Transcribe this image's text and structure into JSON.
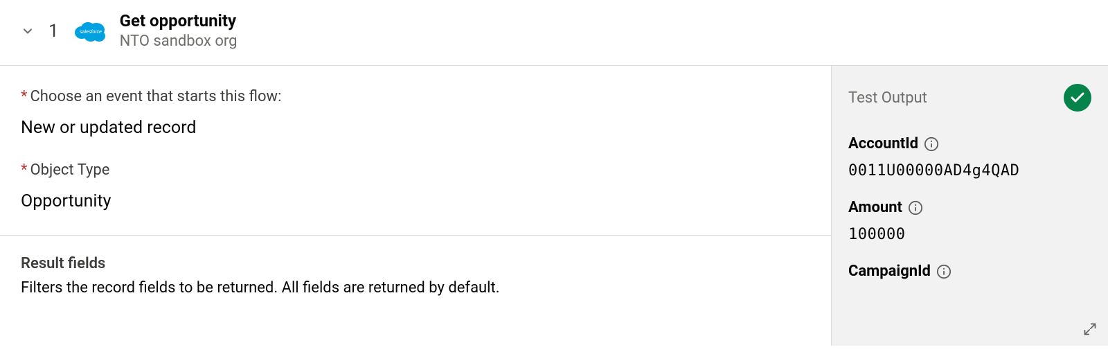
{
  "step": {
    "number": "1",
    "title": "Get opportunity",
    "subtitle": "NTO sandbox org"
  },
  "form": {
    "event_label": "Choose an event that starts this flow:",
    "event_value": "New or updated record",
    "object_type_label": "Object Type",
    "object_type_value": "Opportunity",
    "result_fields_title": "Result fields",
    "result_fields_desc": "Filters the record fields to be returned. All fields are returned by default."
  },
  "output": {
    "title": "Test Output",
    "fields": [
      {
        "name": "AccountId",
        "value": "0011U00000AD4g4QAD"
      },
      {
        "name": "Amount",
        "value": "100000"
      },
      {
        "name": "CampaignId",
        "value": ""
      }
    ]
  }
}
